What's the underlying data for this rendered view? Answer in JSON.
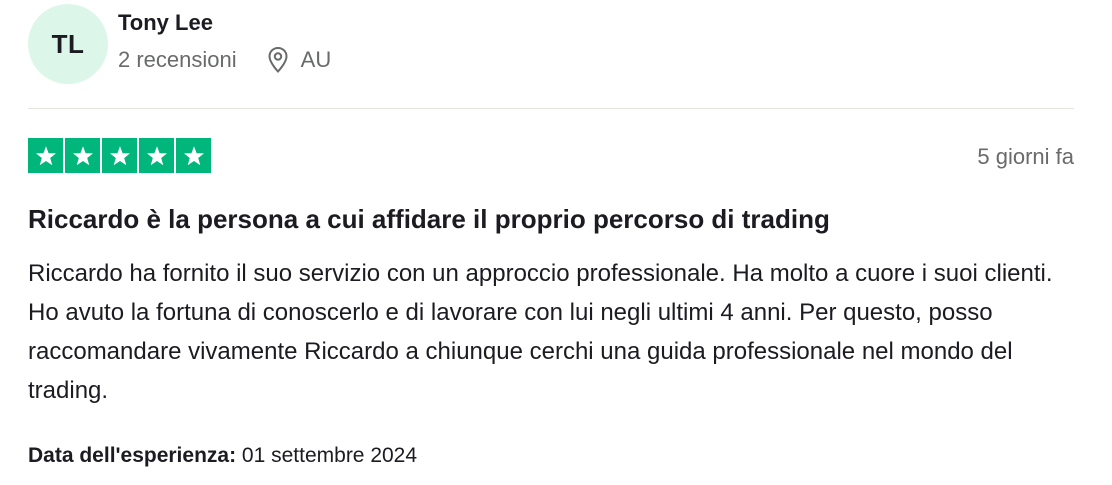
{
  "user": {
    "initials": "TL",
    "name": "Tony Lee",
    "reviews_count": "2 recensioni",
    "country": "AU",
    "avatar_color": "#dcf6ea"
  },
  "review": {
    "rating": 5,
    "star_color": "#00b67a",
    "date_ago": "5 giorni fa",
    "title": "Riccardo è la persona a cui affidare il proprio percorso di trading",
    "body": "Riccardo ha fornito il suo servizio con un approccio professionale. Ha molto a cuore i suoi clienti. Ho avuto la fortuna di conoscerlo e di lavorare con lui negli ultimi 4 anni. Per questo, posso raccomandare vivamente Riccardo a chiunque cerchi una guida professionale nel mondo del trading.",
    "experience_label": "Data dell'esperienza:",
    "experience_date": "01 settembre 2024"
  },
  "icons": {
    "location": "location-pin-icon",
    "star": "star-icon"
  }
}
